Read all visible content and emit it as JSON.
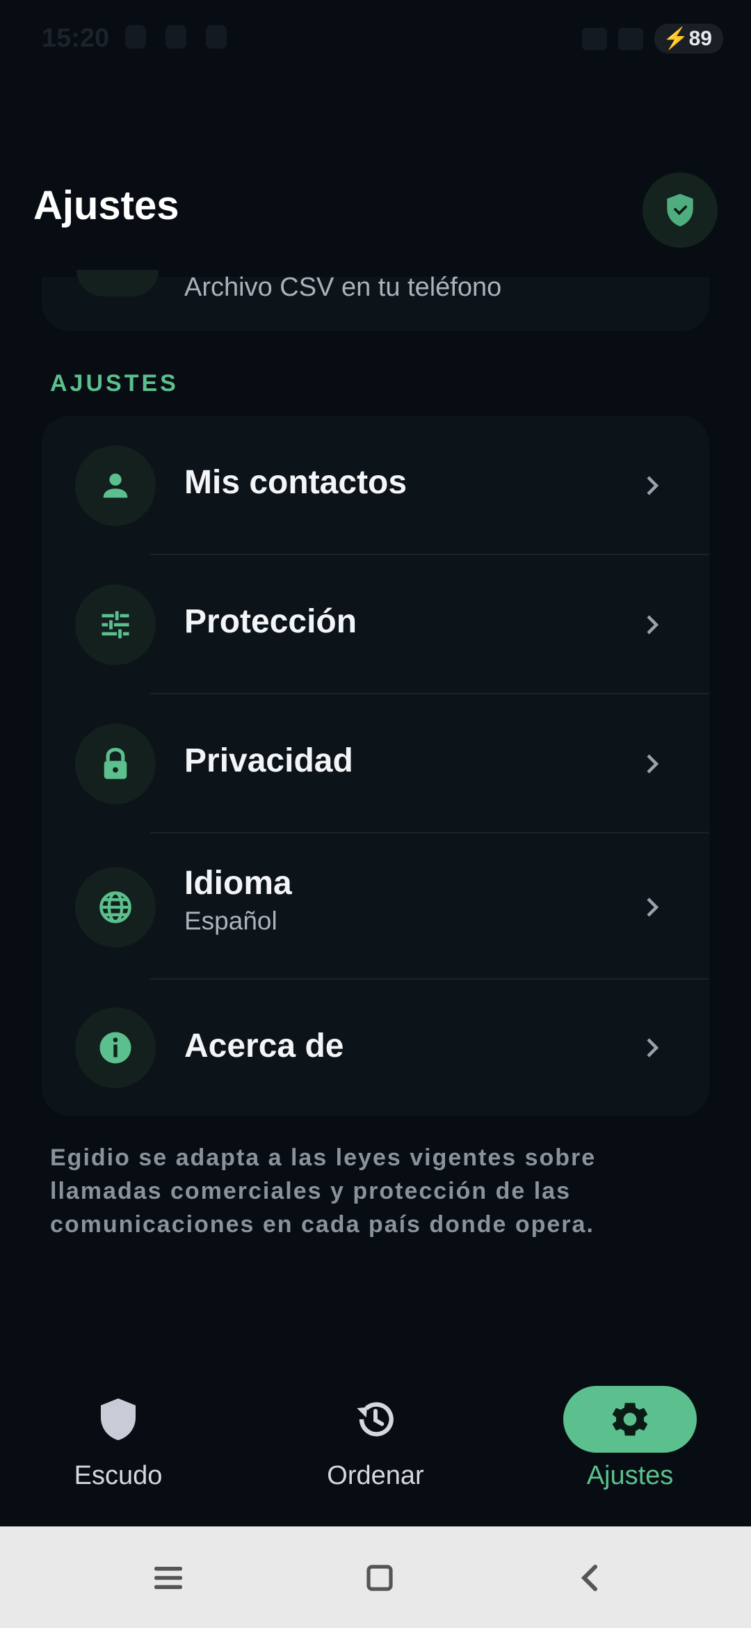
{
  "status_bar": {
    "time": "15:20",
    "battery": "89"
  },
  "header": {
    "title": "Ajustes"
  },
  "top_card": {
    "subtitle": "Archivo CSV en tu teléfono"
  },
  "section": {
    "label": "AJUSTES"
  },
  "settings": {
    "items": [
      {
        "label": "Mis contactos",
        "icon": "person-icon"
      },
      {
        "label": "Protección",
        "icon": "tune-icon"
      },
      {
        "label": "Privacidad",
        "icon": "lock-icon"
      },
      {
        "label": "Idioma",
        "subtitle": "Español",
        "icon": "globe-icon"
      },
      {
        "label": "Acerca de",
        "icon": "info-icon"
      }
    ]
  },
  "footnote": "Egidio se adapta a las leyes vigentes sobre llamadas comerciales y protección de las comunicaciones en cada país donde opera.",
  "bottom_nav": {
    "items": [
      {
        "label": "Escudo",
        "icon": "shield-icon"
      },
      {
        "label": "Ordenar",
        "icon": "history-icon"
      },
      {
        "label": "Ajustes",
        "icon": "gear-icon",
        "active": true
      }
    ]
  },
  "colors": {
    "accent": "#5cc08e",
    "background": "#080d14",
    "card": "#0c1319"
  }
}
